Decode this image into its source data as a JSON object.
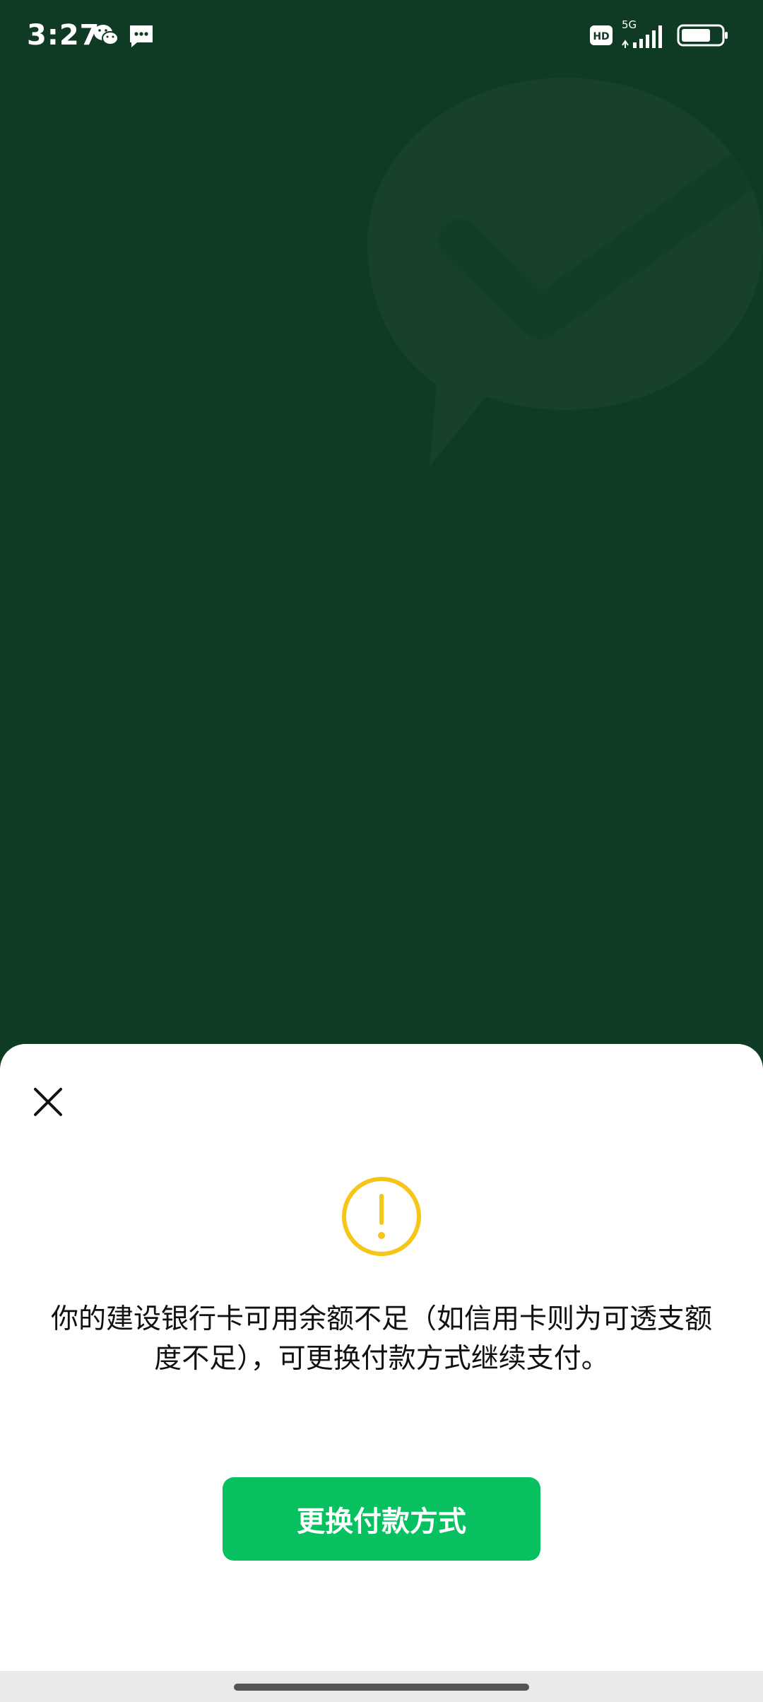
{
  "status_bar": {
    "time": "3:27",
    "network": "5G",
    "hd": "HD"
  },
  "dialog": {
    "message": "你的建设银行卡可用余额不足（如信用卡则为可透支额度不足），可更换付款方式继续支付。",
    "primary_button_label": "更换付款方式"
  },
  "colors": {
    "background": "#0f3a24",
    "accent": "#07c160",
    "warning": "#f5c518"
  }
}
